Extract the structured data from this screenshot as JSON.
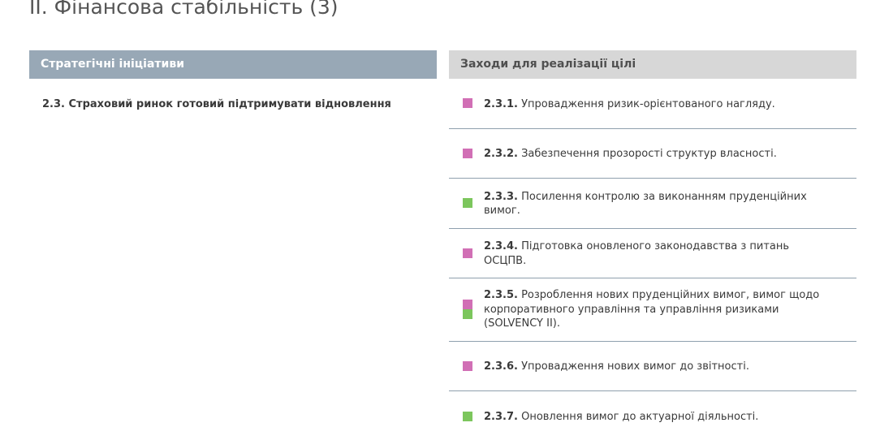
{
  "title": "II. Фінансова стабільність (3)",
  "colors": {
    "pink": "#d16fb5",
    "green": "#7cc65d",
    "left_header_bg": "#98a8b6",
    "right_header_bg": "#d7d7d7"
  },
  "left": {
    "header": "Стратегічні ініціативи",
    "initiative": "2.3. Страховий ринок готовий підтримувати відновлення"
  },
  "right": {
    "header": "Заходи для реалізації цілі",
    "items": [
      {
        "num": "2.3.1.",
        "text": " Упровадження ризик-орієнтованого нагляду.",
        "markers": [
          "pink"
        ]
      },
      {
        "num": "2.3.2.",
        "text": " Забезпечення прозорості структур власності.",
        "markers": [
          "pink"
        ]
      },
      {
        "num": "2.3.3.",
        "text": " Посилення контролю за виконанням пруденційних вимог.",
        "markers": [
          "green"
        ]
      },
      {
        "num": "2.3.4.",
        "text": " Підготовка оновленого законодавства з питань ОСЦПВ.",
        "markers": [
          "pink"
        ]
      },
      {
        "num": "2.3.5.",
        "text": " Розроблення нових пруденційних вимог, вимог щодо корпоративного управління та управління ризиками (SOLVENCY II).",
        "markers": [
          "pink",
          "green"
        ]
      },
      {
        "num": "2.3.6.",
        "text": " Упровадження нових вимог до звітності.",
        "markers": [
          "pink"
        ]
      },
      {
        "num": "2.3.7.",
        "text": " Оновлення вимог до актуарної діяльності.",
        "markers": [
          "green"
        ]
      }
    ]
  }
}
